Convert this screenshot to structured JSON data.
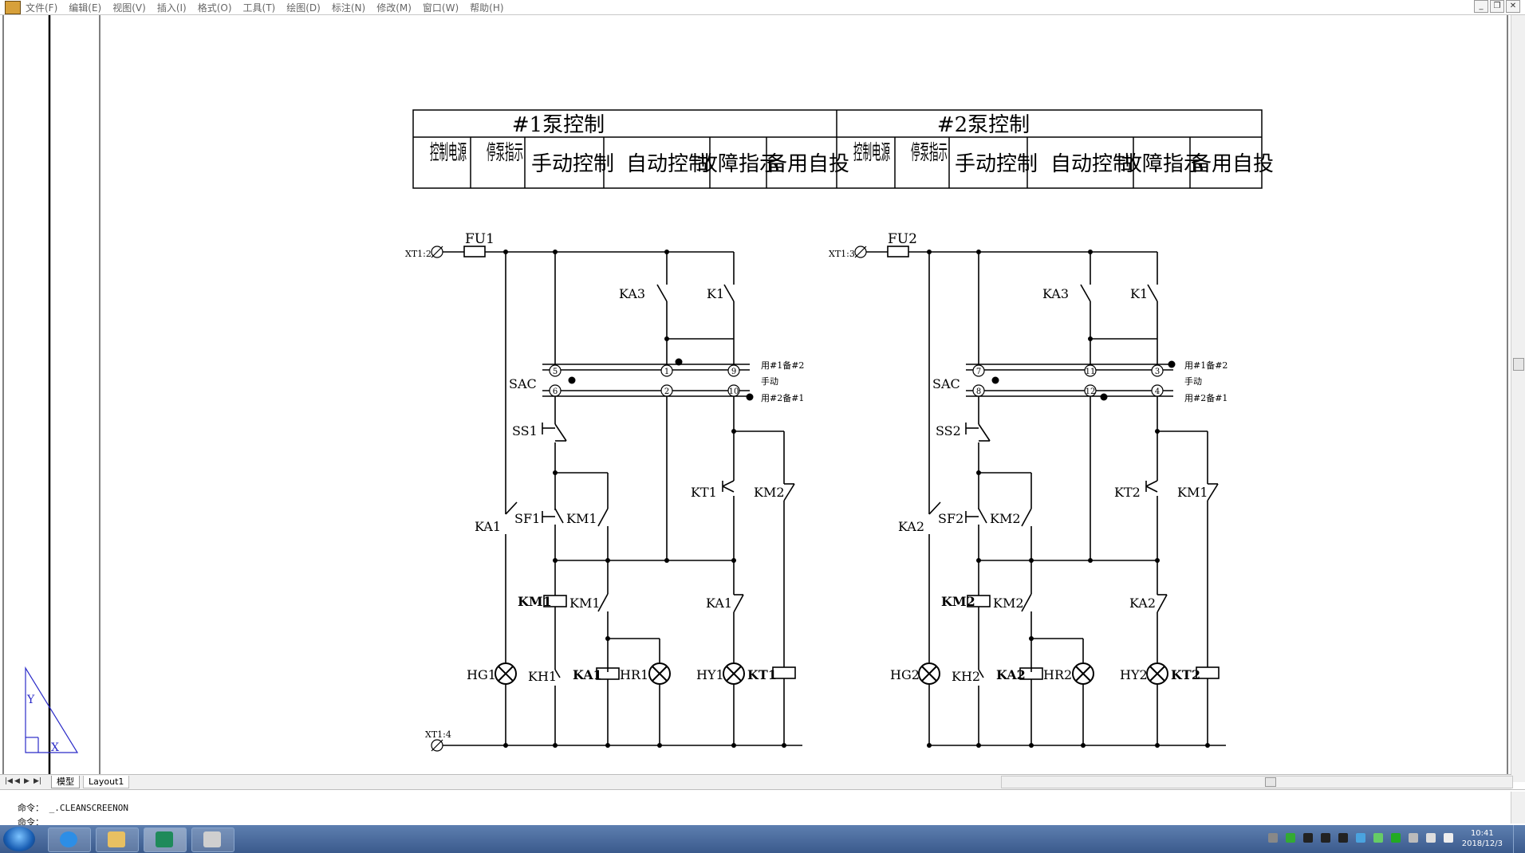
{
  "menu": [
    "文件(F)",
    "编辑(E)",
    "视图(V)",
    "插入(I)",
    "格式(O)",
    "工具(T)",
    "绘图(D)",
    "标注(N)",
    "修改(M)",
    "窗口(W)",
    "帮助(H)"
  ],
  "table": {
    "pump1_header": "#1泵控制",
    "pump2_header": "#2泵控制",
    "cols": [
      "控制电源",
      "停泵指示",
      "手动控制",
      "自动控制",
      "故障指示",
      "备用自投"
    ]
  },
  "circuit1": {
    "terminal_top": "XT1:2",
    "fuse": "FU1",
    "ka3": "KA3",
    "k1": "K1",
    "sac": "SAC",
    "sac_t": [
      "5",
      "1",
      "9",
      "6",
      "2",
      "10"
    ],
    "pos": [
      "用#1备#2",
      "手动",
      "用#2备#1"
    ],
    "ss": "SS1",
    "sf": "SF1",
    "km_a": "KM1",
    "kt": "KT1",
    "km_b": "KM2",
    "ka": "KA1",
    "coil_km": "KM1",
    "km_c": "KM1",
    "ka_b": "KA1",
    "hg": "HG1",
    "kh": "KH1",
    "coil_ka": "KA1",
    "hr": "HR1",
    "hy": "HY1",
    "coil_kt": "KT1",
    "terminal_bottom": "XT1:4"
  },
  "circuit2": {
    "terminal_top": "XT1:3",
    "fuse": "FU2",
    "ka3": "KA3",
    "k1": "K1",
    "sac": "SAC",
    "sac_t": [
      "7",
      "11",
      "3",
      "8",
      "12",
      "4"
    ],
    "pos": [
      "用#1备#2",
      "手动",
      "用#2备#1"
    ],
    "ss": "SS2",
    "sf": "SF2",
    "km_a": "KM2",
    "kt": "KT2",
    "km_b": "KM1",
    "ka": "KA2",
    "coil_km": "KM2",
    "km_c": "KM2",
    "ka_b": "KA2",
    "hg": "HG2",
    "kh": "KH2",
    "coil_ka": "KA2",
    "hr": "HR2",
    "hy": "HY2",
    "coil_kt": "KT2"
  },
  "ucs": {
    "x": "X",
    "y": "Y"
  },
  "tabs": {
    "model": "模型",
    "layout": "Layout1"
  },
  "command": {
    "prompt": "命令：",
    "text": "_.CLEANSCREENON",
    "line2": "命令："
  },
  "clock": {
    "time": "10:41",
    "date": "2018/12/3"
  }
}
